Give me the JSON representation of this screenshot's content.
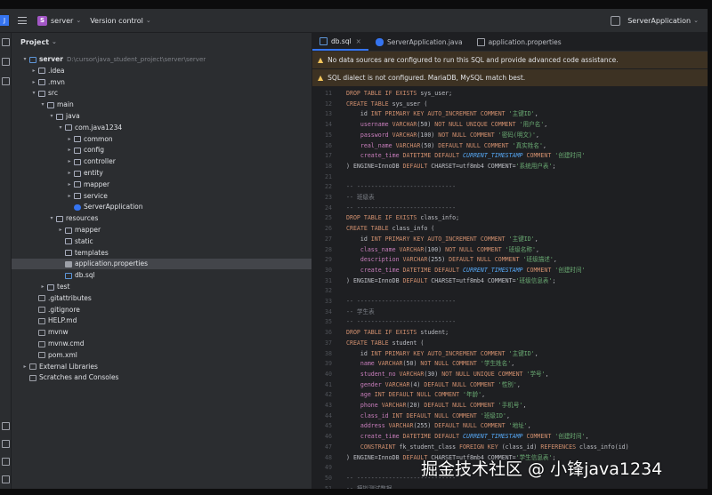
{
  "titlebar": {
    "project_badge": "S",
    "project_name": "server",
    "vcs": "Version control",
    "run_config": "ServerApplication"
  },
  "project_panel": {
    "title": "Project",
    "tree": [
      {
        "depth": 0,
        "arrow": "v",
        "icon": "module",
        "label": "server",
        "path": "D:\\cursor\\java_student_project\\server\\server",
        "bold": true
      },
      {
        "depth": 1,
        "arrow": ">",
        "icon": "folder",
        "label": ".idea"
      },
      {
        "depth": 1,
        "arrow": ">",
        "icon": "folder",
        "label": ".mvn"
      },
      {
        "depth": 1,
        "arrow": "v",
        "icon": "folder",
        "label": "src"
      },
      {
        "depth": 2,
        "arrow": "v",
        "icon": "folder",
        "label": "main"
      },
      {
        "depth": 3,
        "arrow": "v",
        "icon": "folder",
        "label": "java"
      },
      {
        "depth": 4,
        "arrow": "v",
        "icon": "folder",
        "label": "com.java1234"
      },
      {
        "depth": 5,
        "arrow": ">",
        "icon": "folder",
        "label": "common"
      },
      {
        "depth": 5,
        "arrow": ">",
        "icon": "folder",
        "label": "config"
      },
      {
        "depth": 5,
        "arrow": ">",
        "icon": "folder",
        "label": "controller"
      },
      {
        "depth": 5,
        "arrow": ">",
        "icon": "folder",
        "label": "entity"
      },
      {
        "depth": 5,
        "arrow": ">",
        "icon": "folder",
        "label": "mapper"
      },
      {
        "depth": 5,
        "arrow": ">",
        "icon": "folder",
        "label": "service"
      },
      {
        "depth": 5,
        "arrow": "",
        "icon": "class",
        "label": "ServerApplication"
      },
      {
        "depth": 3,
        "arrow": "v",
        "icon": "folder",
        "label": "resources"
      },
      {
        "depth": 4,
        "arrow": ">",
        "icon": "folder",
        "label": "mapper"
      },
      {
        "depth": 4,
        "arrow": "",
        "icon": "folder",
        "label": "static"
      },
      {
        "depth": 4,
        "arrow": "",
        "icon": "folder",
        "label": "templates"
      },
      {
        "depth": 4,
        "arrow": "",
        "icon": "prop",
        "label": "application.properties",
        "selected": true
      },
      {
        "depth": 4,
        "arrow": "",
        "icon": "sql",
        "label": "db.sql"
      },
      {
        "depth": 2,
        "arrow": ">",
        "icon": "folder",
        "label": "test"
      },
      {
        "depth": 1,
        "arrow": "",
        "icon": "file",
        "label": ".gitattributes"
      },
      {
        "depth": 1,
        "arrow": "",
        "icon": "file",
        "label": ".gitignore"
      },
      {
        "depth": 1,
        "arrow": "",
        "icon": "file",
        "label": "HELP.md"
      },
      {
        "depth": 1,
        "arrow": "",
        "icon": "file",
        "label": "mvnw"
      },
      {
        "depth": 1,
        "arrow": "",
        "icon": "file",
        "label": "mvnw.cmd"
      },
      {
        "depth": 1,
        "arrow": "",
        "icon": "file",
        "label": "pom.xml"
      },
      {
        "depth": 0,
        "arrow": ">",
        "icon": "file",
        "label": "External Libraries"
      },
      {
        "depth": 0,
        "arrow": "",
        "icon": "file",
        "label": "Scratches and Consoles"
      }
    ]
  },
  "editor": {
    "tabs": [
      {
        "label": "db.sql",
        "icon": "sql",
        "active": true
      },
      {
        "label": "ServerApplication.java",
        "icon": "class",
        "active": false
      },
      {
        "label": "application.properties",
        "icon": "prop",
        "active": false
      }
    ],
    "banner1": "No data sources are configured to run this SQL and provide advanced code assistance.",
    "banner2": "SQL dialect is not configured. MariaDB, MySQL match best.",
    "lines": [
      {
        "n": "11",
        "t": [
          [
            "kw",
            "DROP TABLE IF EXISTS "
          ],
          [
            "tx",
            "sys_user;"
          ]
        ]
      },
      {
        "n": "12",
        "t": [
          [
            "kw",
            "CREATE TABLE "
          ],
          [
            "tx",
            "sys_user ("
          ]
        ]
      },
      {
        "n": "13",
        "t": [
          [
            "tx",
            "    id "
          ],
          [
            "ty",
            "INT PRIMARY KEY AUTO_INCREMENT COMMENT "
          ],
          [
            "str",
            "'主键ID'"
          ],
          [
            "tx",
            ","
          ]
        ]
      },
      {
        "n": "14",
        "t": [
          [
            "id",
            "    username "
          ],
          [
            "ty",
            "VARCHAR"
          ],
          [
            "tx",
            "(50) "
          ],
          [
            "kw",
            "NOT NULL UNIQUE COMMENT "
          ],
          [
            "str",
            "'用户名'"
          ],
          [
            "tx",
            ","
          ]
        ]
      },
      {
        "n": "15",
        "t": [
          [
            "id",
            "    password "
          ],
          [
            "ty",
            "VARCHAR"
          ],
          [
            "tx",
            "(100) "
          ],
          [
            "kw",
            "NOT NULL COMMENT "
          ],
          [
            "str",
            "'密码(明文)'"
          ],
          [
            "tx",
            ","
          ]
        ]
      },
      {
        "n": "16",
        "t": [
          [
            "id",
            "    real_name "
          ],
          [
            "ty",
            "VARCHAR"
          ],
          [
            "tx",
            "(50) "
          ],
          [
            "kw",
            "DEFAULT NULL COMMENT "
          ],
          [
            "str",
            "'真实姓名'"
          ],
          [
            "tx",
            ","
          ]
        ]
      },
      {
        "n": "17",
        "t": [
          [
            "id",
            "    create_time "
          ],
          [
            "ty",
            "DATETIME DEFAULT "
          ],
          [
            "fn",
            "CURRENT_TIMESTAMP"
          ],
          [
            "kw",
            " COMMENT "
          ],
          [
            "str",
            "'创建时间'"
          ]
        ]
      },
      {
        "n": "18",
        "t": [
          [
            "tx",
            ") ENGINE=InnoDB "
          ],
          [
            "kw",
            "DEFAULT "
          ],
          [
            "tx",
            "CHARSET=utf8mb4 COMMENT="
          ],
          [
            "str",
            "'系统用户表'"
          ],
          [
            "tx",
            ";"
          ]
        ]
      },
      {
        "n": "21",
        "t": []
      },
      {
        "n": "22",
        "t": [
          [
            "cm",
            "-- ----------------------------"
          ]
        ]
      },
      {
        "n": "23",
        "t": [
          [
            "cm",
            "-- 班级表"
          ]
        ]
      },
      {
        "n": "24",
        "t": [
          [
            "cm",
            "-- ----------------------------"
          ]
        ]
      },
      {
        "n": "25",
        "t": [
          [
            "kw",
            "DROP TABLE IF EXISTS "
          ],
          [
            "tx",
            "class_info;"
          ]
        ]
      },
      {
        "n": "26",
        "t": [
          [
            "kw",
            "CREATE TABLE "
          ],
          [
            "tx",
            "class_info ("
          ]
        ]
      },
      {
        "n": "27",
        "t": [
          [
            "tx",
            "    id "
          ],
          [
            "ty",
            "INT PRIMARY KEY AUTO_INCREMENT COMMENT "
          ],
          [
            "str",
            "'主键ID'"
          ],
          [
            "tx",
            ","
          ]
        ]
      },
      {
        "n": "28",
        "t": [
          [
            "id",
            "    class_name "
          ],
          [
            "ty",
            "VARCHAR"
          ],
          [
            "tx",
            "(100) "
          ],
          [
            "kw",
            "NOT NULL COMMENT "
          ],
          [
            "str",
            "'班级名称'"
          ],
          [
            "tx",
            ","
          ]
        ]
      },
      {
        "n": "29",
        "t": [
          [
            "id",
            "    description "
          ],
          [
            "ty",
            "VARCHAR"
          ],
          [
            "tx",
            "(255) "
          ],
          [
            "kw",
            "DEFAULT NULL COMMENT "
          ],
          [
            "str",
            "'班级描述'"
          ],
          [
            "tx",
            ","
          ]
        ]
      },
      {
        "n": "30",
        "t": [
          [
            "id",
            "    create_time "
          ],
          [
            "ty",
            "DATETIME DEFAULT "
          ],
          [
            "fn",
            "CURRENT_TIMESTAMP"
          ],
          [
            "kw",
            " COMMENT "
          ],
          [
            "str",
            "'创建时间'"
          ]
        ]
      },
      {
        "n": "31",
        "t": [
          [
            "tx",
            ") ENGINE=InnoDB "
          ],
          [
            "kw",
            "DEFAULT "
          ],
          [
            "tx",
            "CHARSET=utf8mb4 COMMENT="
          ],
          [
            "str",
            "'班级信息表'"
          ],
          [
            "tx",
            ";"
          ]
        ]
      },
      {
        "n": "32",
        "t": []
      },
      {
        "n": "33",
        "t": [
          [
            "cm",
            "-- ----------------------------"
          ]
        ]
      },
      {
        "n": "34",
        "t": [
          [
            "cm",
            "-- 学生表"
          ]
        ]
      },
      {
        "n": "35",
        "t": [
          [
            "cm",
            "-- ----------------------------"
          ]
        ]
      },
      {
        "n": "36",
        "t": [
          [
            "kw",
            "DROP TABLE IF EXISTS "
          ],
          [
            "tx",
            "student;"
          ]
        ]
      },
      {
        "n": "37",
        "t": [
          [
            "kw",
            "CREATE TABLE "
          ],
          [
            "tx",
            "student ("
          ]
        ]
      },
      {
        "n": "38",
        "t": [
          [
            "tx",
            "    id "
          ],
          [
            "ty",
            "INT PRIMARY KEY AUTO_INCREMENT COMMENT "
          ],
          [
            "str",
            "'主键ID'"
          ],
          [
            "tx",
            ","
          ]
        ]
      },
      {
        "n": "39",
        "t": [
          [
            "id",
            "    name "
          ],
          [
            "ty",
            "VARCHAR"
          ],
          [
            "tx",
            "(50) "
          ],
          [
            "kw",
            "NOT NULL COMMENT "
          ],
          [
            "str",
            "'学生姓名'"
          ],
          [
            "tx",
            ","
          ]
        ]
      },
      {
        "n": "40",
        "t": [
          [
            "id",
            "    student_no "
          ],
          [
            "ty",
            "VARCHAR"
          ],
          [
            "tx",
            "(30) "
          ],
          [
            "kw",
            "NOT NULL UNIQUE COMMENT "
          ],
          [
            "str",
            "'学号'"
          ],
          [
            "tx",
            ","
          ]
        ]
      },
      {
        "n": "41",
        "t": [
          [
            "id",
            "    gender "
          ],
          [
            "ty",
            "VARCHAR"
          ],
          [
            "tx",
            "(4) "
          ],
          [
            "kw",
            "DEFAULT NULL COMMENT "
          ],
          [
            "str",
            "'性别'"
          ],
          [
            "tx",
            ","
          ]
        ]
      },
      {
        "n": "42",
        "t": [
          [
            "id",
            "    age "
          ],
          [
            "ty",
            "INT DEFAULT NULL COMMENT "
          ],
          [
            "str",
            "'年龄'"
          ],
          [
            "tx",
            ","
          ]
        ]
      },
      {
        "n": "43",
        "t": [
          [
            "id",
            "    phone "
          ],
          [
            "ty",
            "VARCHAR"
          ],
          [
            "tx",
            "(20) "
          ],
          [
            "kw",
            "DEFAULT NULL COMMENT "
          ],
          [
            "str",
            "'手机号'"
          ],
          [
            "tx",
            ","
          ]
        ]
      },
      {
        "n": "44",
        "t": [
          [
            "id",
            "    class_id "
          ],
          [
            "ty",
            "INT DEFAULT NULL COMMENT "
          ],
          [
            "str",
            "'班级ID'"
          ],
          [
            "tx",
            ","
          ]
        ]
      },
      {
        "n": "45",
        "t": [
          [
            "id",
            "    address "
          ],
          [
            "ty",
            "VARCHAR"
          ],
          [
            "tx",
            "(255) "
          ],
          [
            "kw",
            "DEFAULT NULL COMMENT "
          ],
          [
            "str",
            "'地址'"
          ],
          [
            "tx",
            ","
          ]
        ]
      },
      {
        "n": "46",
        "t": [
          [
            "id",
            "    create_time "
          ],
          [
            "ty",
            "DATETIME DEFAULT "
          ],
          [
            "fn",
            "CURRENT_TIMESTAMP"
          ],
          [
            "kw",
            " COMMENT "
          ],
          [
            "str",
            "'创建时间'"
          ],
          [
            "tx",
            ","
          ]
        ]
      },
      {
        "n": "47",
        "t": [
          [
            "kw",
            "    CONSTRAINT "
          ],
          [
            "tx",
            "fk_student_class "
          ],
          [
            "kw",
            "FOREIGN KEY "
          ],
          [
            "tx",
            "(class_id) "
          ],
          [
            "kw",
            "REFERENCES "
          ],
          [
            "tx",
            "class_info(id)"
          ]
        ]
      },
      {
        "n": "48",
        "t": [
          [
            "tx",
            ") ENGINE=InnoDB "
          ],
          [
            "kw",
            "DEFAULT "
          ],
          [
            "tx",
            "CHARSET=utf8mb4 COMMENT="
          ],
          [
            "str",
            "'学生信息表'"
          ],
          [
            "tx",
            ";"
          ]
        ]
      },
      {
        "n": "49",
        "t": []
      },
      {
        "n": "50",
        "t": [
          [
            "cm",
            "-- ----------------------------"
          ]
        ]
      },
      {
        "n": "51",
        "t": [
          [
            "cm",
            "-- 模拟测试数据"
          ]
        ]
      }
    ]
  },
  "watermark": "掘金技术社区 @ 小锋java1234"
}
